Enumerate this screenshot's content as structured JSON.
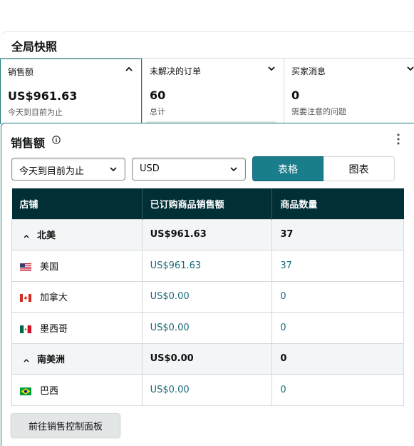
{
  "snapshot": {
    "title": "全局快照"
  },
  "cards": [
    {
      "title": "销售额",
      "value": "US$961.63",
      "subtitle": "今天到目前为止",
      "chevron": "chevron-up-icon"
    },
    {
      "title": "未解决的订单",
      "value": "60",
      "subtitle": "总计",
      "chevron": "chevron-down-icon"
    },
    {
      "title": "买家消息",
      "value": "0",
      "subtitle": "需要注意的问题",
      "chevron": "chevron-down-icon"
    }
  ],
  "panel": {
    "title": "销售额",
    "period_select": "今天到目前为止",
    "currency_select": "USD",
    "toggle": {
      "table": "表格",
      "chart": "图表",
      "selected": "表格"
    }
  },
  "table": {
    "headers": [
      "店铺",
      "已订购商品销售额",
      "商品数量"
    ],
    "rows": [
      {
        "type": "group",
        "store": "北美",
        "sales": "US$961.63",
        "qty": "37"
      },
      {
        "type": "sub",
        "flag": "us",
        "store": "美国",
        "sales": "US$961.63",
        "qty": "37"
      },
      {
        "type": "sub",
        "flag": "ca",
        "store": "加拿大",
        "sales": "US$0.00",
        "qty": "0"
      },
      {
        "type": "sub",
        "flag": "mx",
        "store": "墨西哥",
        "sales": "US$0.00",
        "qty": "0"
      },
      {
        "type": "group",
        "store": "南美洲",
        "sales": "US$0.00",
        "qty": "0"
      },
      {
        "type": "sub",
        "flag": "br",
        "store": "巴西",
        "sales": "US$0.00",
        "qty": "0"
      }
    ]
  },
  "footer": {
    "button": "前往销售控制面板"
  },
  "colors": {
    "accent": "#1a7d8c",
    "header_bg": "#002f36",
    "link": "#1a6a7a"
  }
}
